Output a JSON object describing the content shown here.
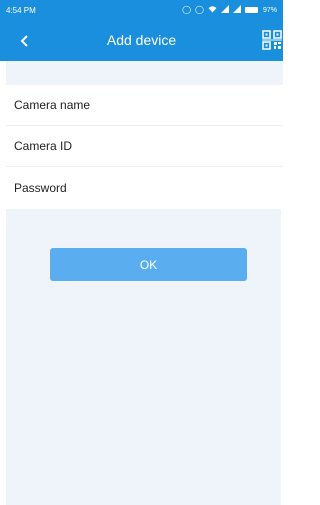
{
  "status_bar": {
    "time": "4:54 PM",
    "battery_percent": "97%",
    "icons": [
      "vibrate-icon",
      "alarm-icon",
      "wifi-icon",
      "signal-icon",
      "signal-icon",
      "battery-icon"
    ]
  },
  "app_bar": {
    "title": "Add device",
    "back_icon": "chevron-left-icon",
    "qr_icon": "qr-code-scan-icon"
  },
  "form": {
    "fields": [
      {
        "label": "Camera name"
      },
      {
        "label": "Camera ID"
      },
      {
        "label": "Password"
      }
    ]
  },
  "actions": {
    "ok_label": "OK"
  },
  "colors": {
    "primary": "#1a8fdd",
    "button": "#5aaef0",
    "background": "#eff3fa"
  }
}
